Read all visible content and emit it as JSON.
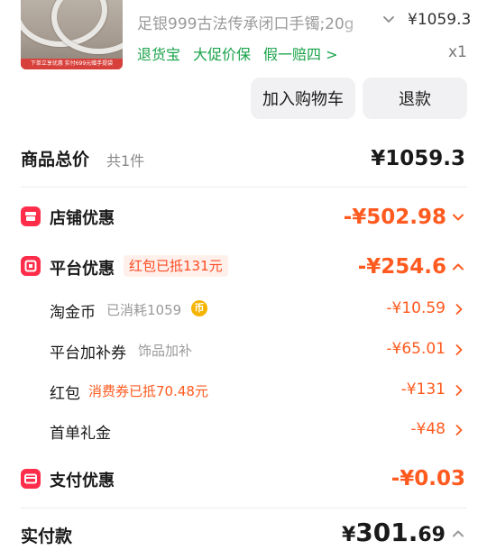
{
  "product": {
    "thumb_banner": "下单立享优惠 实付699元赠手提袋",
    "title": "足银999古法传承闭口手镯;20g",
    "price": "¥1059.3",
    "tags": [
      "退货宝",
      "大促价保",
      "假一赔四 >"
    ],
    "qty": "x1"
  },
  "actions": {
    "add_to_cart": "加入购物车",
    "refund": "退款"
  },
  "summary": {
    "total_label": "商品总价",
    "count_label": "共1件",
    "total_amount": "¥1059.3",
    "shop_label": "店铺优惠",
    "shop_amount": "-¥502.98",
    "platform_label": "平台优惠",
    "platform_badge": "红包已抵131元",
    "platform_amount": "-¥254.6",
    "sub_items": [
      {
        "label": "淘金币",
        "note": "已消耗1059",
        "amount": "-¥10.59"
      },
      {
        "label": "平台加补券",
        "note": "饰品加补",
        "amount": "-¥65.01"
      },
      {
        "label": "红包",
        "note": "消费券已抵70.48元",
        "amount": "-¥131"
      },
      {
        "label": "首单礼金",
        "note": "",
        "amount": "-¥48"
      }
    ],
    "coin_glyph": "币",
    "pay_label": "支付优惠",
    "pay_amount": "-¥0.03",
    "paid_label": "实付款",
    "paid_currency": "¥",
    "paid_int": "301.",
    "paid_dec": "69"
  },
  "colors": {
    "accent_orange": "#ff5a1f",
    "icon_red": "#ff2d4a",
    "tag_green": "#1aa34a"
  }
}
